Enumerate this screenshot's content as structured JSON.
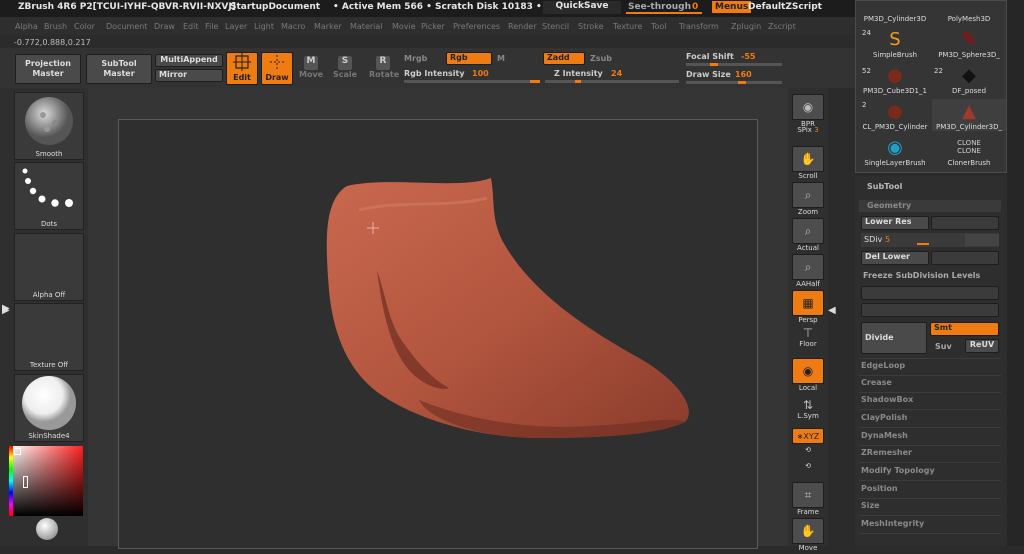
{
  "titlebar": {
    "app": "ZBrush 4R6 P2[TCUI-IYHF-QBVR-RVII-NXVJ]",
    "doc": "StartupDocument",
    "mem": "• Active Mem 566 • Scratch Disk 10183 • F",
    "quicksave": "QuickSave",
    "seethrough": "See-through",
    "seethrough_value": "0",
    "menus": "Menus",
    "script": "DefaultZScript"
  },
  "menubar": [
    "Alpha",
    "Brush",
    "Color",
    "Document",
    "Draw",
    "Edit",
    "File",
    "Layer",
    "Light",
    "Macro",
    "Marker",
    "Material",
    "Movie",
    "Picker",
    "Preferences",
    "Render",
    "Stencil",
    "Stroke",
    "Texture",
    "Tool",
    "Transform",
    "Zplugin",
    "Zscript"
  ],
  "coords": "-0.772,0.888,0.217",
  "toolbar": {
    "projection_master": "Projection\nMaster",
    "subtool_master": "SubTool\nMaster",
    "multiappend": "MultiAppend",
    "mirror": "Mirror",
    "edit": "Edit",
    "draw": "Draw",
    "move": "Move",
    "scale": "Scale",
    "rotate": "Rotate",
    "mrgb": "Mrgb",
    "rgb": "Rgb",
    "m": "M",
    "rgb_intensity_label": "Rgb Intensity",
    "rgb_intensity_value": "100",
    "zadd": "Zadd",
    "zsub": "Zsub",
    "z_intensity_label": "Z Intensity",
    "z_intensity_value": "24",
    "focal_shift_label": "Focal Shift",
    "focal_shift_value": "-55",
    "draw_size_label": "Draw Size",
    "draw_size_value": "160"
  },
  "left": {
    "smooth": "Smooth",
    "dots": "Dots",
    "alpha": "Alpha Off",
    "texture": "Texture Off",
    "material": "SkinShade4"
  },
  "right": {
    "bpr": "BPR",
    "spix_label": "SPix",
    "spix_value": "3",
    "scroll": "Scroll",
    "zoom": "Zoom",
    "actual": "Actual",
    "aahalf": "AAHalf",
    "persp": "Persp",
    "floor": "Floor",
    "local": "Local",
    "lsym": "L.Sym",
    "xyz": "∗XYZ",
    "frame": "Frame",
    "move": "Move"
  },
  "brushes": [
    {
      "label": "PM3D_Cylinder3D",
      "sub": ""
    },
    {
      "label": "PolyMesh3D",
      "sub": "24"
    },
    {
      "label": "SimpleBrush",
      "sub": "52"
    },
    {
      "label": "PM3D_Sphere3D_",
      "sub": "22"
    },
    {
      "label": "PM3D_Cube3D1_1",
      "sub": "2"
    },
    {
      "label": "DF_posed",
      "sub": ""
    },
    {
      "label": "CL_PM3D_Cylinder",
      "sub": ""
    },
    {
      "label": "PM3D_Cylinder3D_",
      "sub": ""
    },
    {
      "label": "SingleLayerBrush",
      "sub": ""
    },
    {
      "label": "ClonerBrush",
      "sub": ""
    }
  ],
  "subtool": {
    "title": "SubTool",
    "geometry": "Geometry",
    "lower_res": "Lower Res",
    "sdiv_label": "SDiv",
    "sdiv_value": "5",
    "del_lower": "Del Lower",
    "freeze": "Freeze SubDivision Levels",
    "divide": "Divide",
    "smt": "Smt",
    "suv": "Suv",
    "reuv": "ReUV",
    "items": [
      "EdgeLoop",
      "Crease",
      "ShadowBox",
      "ClayPolish",
      "DynaMesh",
      "ZRemesher",
      "Modify Topology",
      "Position",
      "Size",
      "MeshIntegrity"
    ]
  },
  "colors": {
    "accent": "#ef7c12",
    "mesh": "#b85a47",
    "bg": "#2b2b2b"
  }
}
